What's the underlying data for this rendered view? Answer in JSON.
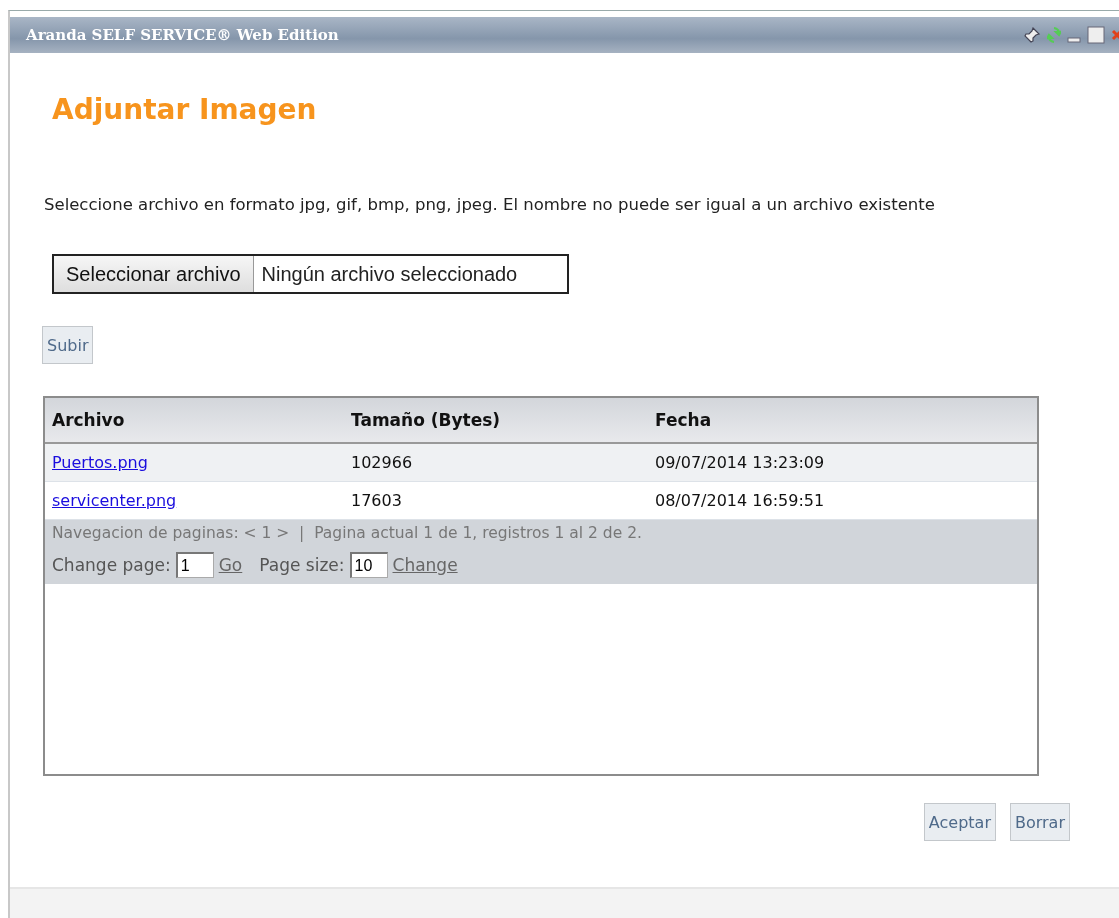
{
  "window": {
    "title": "Aranda SELF SERVICE® Web Edition"
  },
  "heading": "Adjuntar Imagen",
  "instructions": "Seleccione archivo en formato jpg, gif, bmp, png, jpeg. El nombre no puede ser igual a un archivo existente",
  "file_input": {
    "button": "Seleccionar archivo",
    "status": "Ningún archivo seleccionado"
  },
  "upload_button": "Subir",
  "table": {
    "columns": [
      "Archivo",
      "Tamaño (Bytes)",
      "Fecha"
    ],
    "rows": [
      {
        "file": "Puertos.png",
        "size": "102966",
        "date": "09/07/2014 13:23:09"
      },
      {
        "file": "servicenter.png",
        "size": "17603",
        "date": "08/07/2014 16:59:51"
      }
    ]
  },
  "pager": {
    "navigation": "Navegacion de paginas: < 1 >  |  Pagina actual 1 de 1, registros 1 al 2 de 2.",
    "change_page_label": "Change page:",
    "change_page_value": "1",
    "go_link": "Go",
    "page_size_label": "Page size:",
    "page_size_value": "10",
    "change_link": "Change"
  },
  "buttons": [
    "Aceptar",
    "Borrar"
  ]
}
